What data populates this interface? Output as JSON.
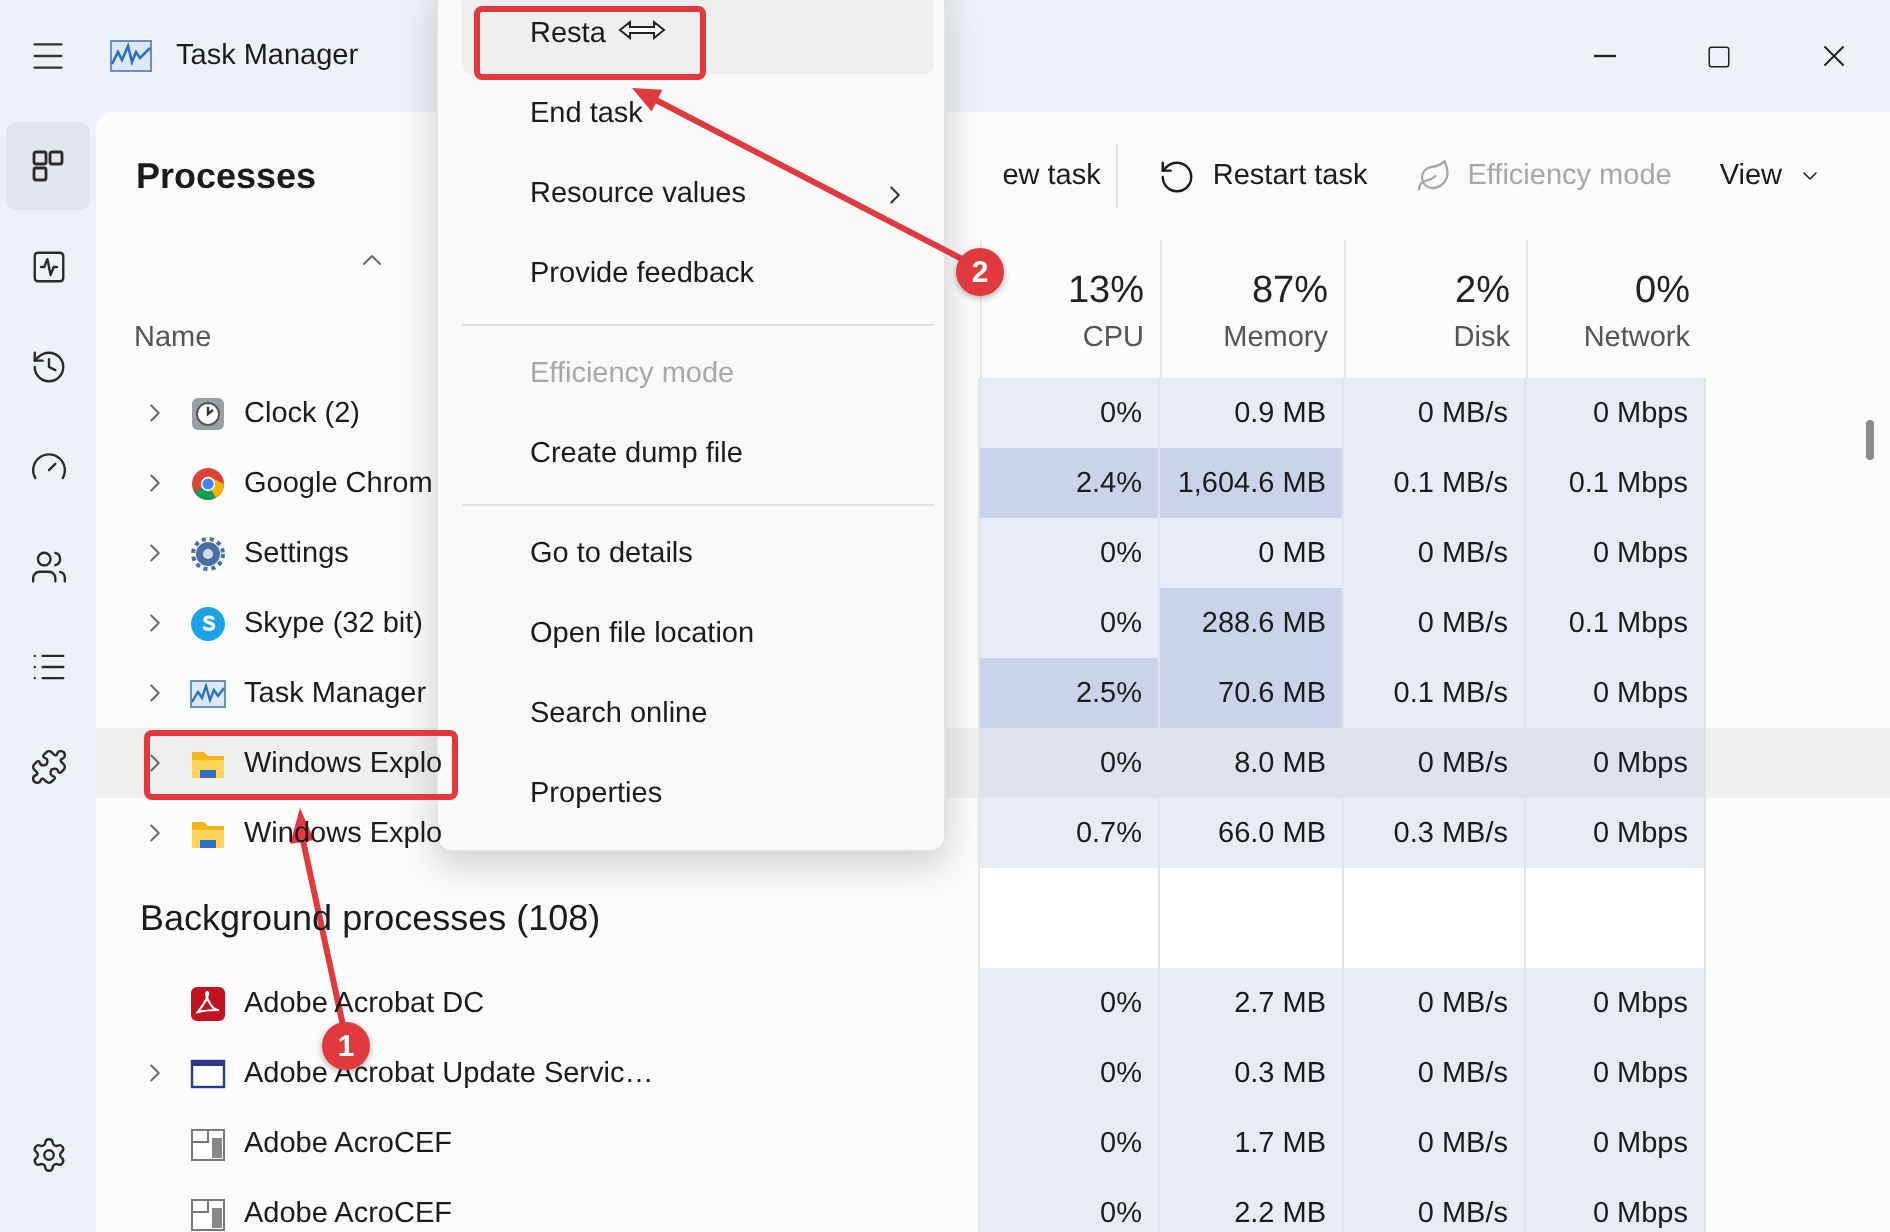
{
  "window": {
    "title": "Task Manager"
  },
  "nav": [
    {
      "kind": "processes",
      "selected": true
    },
    {
      "kind": "performance",
      "selected": false
    },
    {
      "kind": "history",
      "selected": false
    },
    {
      "kind": "startup",
      "selected": false
    },
    {
      "kind": "users",
      "selected": false
    },
    {
      "kind": "details",
      "selected": false
    },
    {
      "kind": "services",
      "selected": false
    },
    {
      "kind": "settings",
      "selected": false
    }
  ],
  "toolbar": {
    "title": "Processes",
    "actions": [
      {
        "kind": "plain",
        "label": "ew task",
        "disabled": false
      },
      {
        "kind": "restart",
        "label": "Restart task",
        "disabled": false
      },
      {
        "kind": "leaf",
        "label": "Efficiency mode",
        "disabled": true
      },
      {
        "kind": "dropdown",
        "label": "View",
        "disabled": false
      }
    ]
  },
  "table": {
    "name_label": "Name",
    "columns": [
      {
        "percent": "13%",
        "label": "CPU"
      },
      {
        "percent": "87%",
        "label": "Memory"
      },
      {
        "percent": "2%",
        "label": "Disk"
      },
      {
        "percent": "0%",
        "label": "Network"
      }
    ],
    "groups": [
      {
        "rows": [
          {
            "kind": "clock",
            "name": "Clock (2)",
            "expandable": true,
            "selected": false,
            "cells": [
              {
                "value": "0%",
                "hot": false
              },
              {
                "value": "0.9 MB",
                "hot": false
              },
              {
                "value": "0 MB/s",
                "hot": false
              },
              {
                "value": "0 Mbps",
                "hot": false
              }
            ]
          },
          {
            "kind": "chrome",
            "name": "Google Chrom",
            "expandable": true,
            "selected": false,
            "cells": [
              {
                "value": "2.4%",
                "hot": true
              },
              {
                "value": "1,604.6 MB",
                "hot": true
              },
              {
                "value": "0.1 MB/s",
                "hot": false
              },
              {
                "value": "0.1 Mbps",
                "hot": false
              }
            ]
          },
          {
            "kind": "gear",
            "name": "Settings",
            "expandable": true,
            "selected": false,
            "cells": [
              {
                "value": "0%",
                "hot": false
              },
              {
                "value": "0 MB",
                "hot": false
              },
              {
                "value": "0 MB/s",
                "hot": false
              },
              {
                "value": "0 Mbps",
                "hot": false
              }
            ]
          },
          {
            "kind": "skype",
            "name": "Skype (32 bit)",
            "expandable": true,
            "selected": false,
            "cells": [
              {
                "value": "0%",
                "hot": false
              },
              {
                "value": "288.6 MB",
                "hot": true
              },
              {
                "value": "0 MB/s",
                "hot": false
              },
              {
                "value": "0.1 Mbps",
                "hot": false
              }
            ]
          },
          {
            "kind": "monitor",
            "name": "Task Manager",
            "expandable": true,
            "selected": false,
            "cells": [
              {
                "value": "2.5%",
                "hot": true
              },
              {
                "value": "70.6 MB",
                "hot": true
              },
              {
                "value": "0.1 MB/s",
                "hot": false
              },
              {
                "value": "0 Mbps",
                "hot": false
              }
            ]
          },
          {
            "kind": "folder",
            "name": "Windows Explo",
            "expandable": true,
            "selected": true,
            "cells": [
              {
                "value": "0%",
                "hot": false
              },
              {
                "value": "8.0 MB",
                "hot": false
              },
              {
                "value": "0 MB/s",
                "hot": false
              },
              {
                "value": "0 Mbps",
                "hot": false
              }
            ]
          },
          {
            "kind": "folder",
            "name": "Windows Explo",
            "expandable": true,
            "selected": false,
            "cells": [
              {
                "value": "0.7%",
                "hot": false
              },
              {
                "value": "66.0 MB",
                "hot": false
              },
              {
                "value": "0.3 MB/s",
                "hot": false
              },
              {
                "value": "0 Mbps",
                "hot": false
              }
            ]
          }
        ]
      },
      {
        "title": "Background processes (108)",
        "rows": [
          {
            "kind": "pdf",
            "name": "Adobe Acrobat DC",
            "expandable": false,
            "selected": false,
            "cells": [
              {
                "value": "0%",
                "hot": false
              },
              {
                "value": "2.7 MB",
                "hot": false
              },
              {
                "value": "0 MB/s",
                "hot": false
              },
              {
                "value": "0 Mbps",
                "hot": false
              }
            ]
          },
          {
            "kind": "window",
            "name": "Adobe Acrobat Update Servic…",
            "expandable": true,
            "selected": false,
            "cells": [
              {
                "value": "0%",
                "hot": false
              },
              {
                "value": "0.3 MB",
                "hot": false
              },
              {
                "value": "0 MB/s",
                "hot": false
              },
              {
                "value": "0 Mbps",
                "hot": false
              }
            ]
          },
          {
            "kind": "app",
            "name": "Adobe AcroCEF",
            "expandable": false,
            "selected": false,
            "cells": [
              {
                "value": "0%",
                "hot": false
              },
              {
                "value": "1.7 MB",
                "hot": false
              },
              {
                "value": "0 MB/s",
                "hot": false
              },
              {
                "value": "0 Mbps",
                "hot": false
              }
            ]
          },
          {
            "kind": "app",
            "name": "Adobe AcroCEF",
            "expandable": false,
            "selected": false,
            "cells": [
              {
                "value": "0%",
                "hot": false
              },
              {
                "value": "2.2 MB",
                "hot": false
              },
              {
                "value": "0 MB/s",
                "hot": false
              },
              {
                "value": "0 Mbps",
                "hot": false
              }
            ]
          }
        ]
      }
    ]
  },
  "context_menu": {
    "items": [
      {
        "kind": "item",
        "label": "Resta",
        "highlighted": true,
        "disabled": false,
        "submenu": false
      },
      {
        "kind": "item",
        "label": "End task",
        "highlighted": false,
        "disabled": false,
        "submenu": false
      },
      {
        "kind": "item",
        "label": "Resource values",
        "highlighted": false,
        "disabled": false,
        "submenu": true
      },
      {
        "kind": "item",
        "label": "Provide feedback",
        "highlighted": false,
        "disabled": false,
        "submenu": false
      },
      {
        "kind": "separator"
      },
      {
        "kind": "item",
        "label": "Efficiency mode",
        "highlighted": false,
        "disabled": true,
        "submenu": false
      },
      {
        "kind": "item",
        "label": "Create dump file",
        "highlighted": false,
        "disabled": false,
        "submenu": false
      },
      {
        "kind": "separator"
      },
      {
        "kind": "item",
        "label": "Go to details",
        "highlighted": false,
        "disabled": false,
        "submenu": false
      },
      {
        "kind": "item",
        "label": "Open file location",
        "highlighted": false,
        "disabled": false,
        "submenu": false
      },
      {
        "kind": "item",
        "label": "Search online",
        "highlighted": false,
        "disabled": false,
        "submenu": false
      },
      {
        "kind": "item",
        "label": "Properties",
        "highlighted": false,
        "disabled": false,
        "submenu": false
      }
    ]
  },
  "annotations": [
    {
      "label": "1"
    },
    {
      "label": "2"
    }
  ]
}
